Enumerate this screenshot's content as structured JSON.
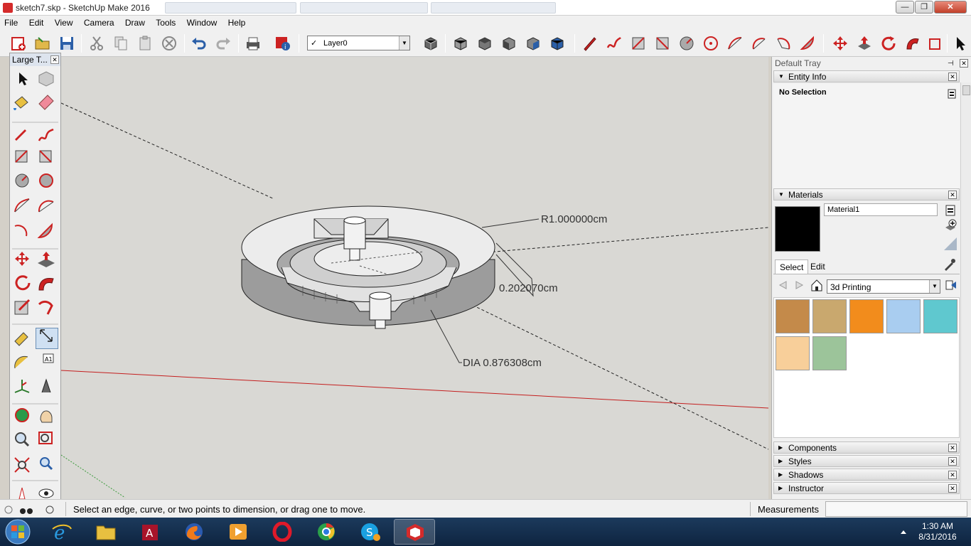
{
  "window": {
    "title": "sketch7.skp - SketchUp Make 2016",
    "minimize": "—",
    "maximize": "❐",
    "close": "✕"
  },
  "menu": [
    "File",
    "Edit",
    "View",
    "Camera",
    "Draw",
    "Tools",
    "Window",
    "Help"
  ],
  "toolbar": {
    "layer_checkmark": "✓",
    "layer_value": "Layer0",
    "dropdown_arrow": "▼"
  },
  "large_toolset": {
    "title": "Large T...",
    "close": "✕"
  },
  "viewport": {
    "dimensions": {
      "radius": "R1.000000cm",
      "linear": "0.202070cm",
      "diameter": "DIA 0.876308cm"
    }
  },
  "tray": {
    "title": "Default Tray",
    "pin": "⊣",
    "close": "✕",
    "entity_info": {
      "header": "Entity Info",
      "status": "No Selection"
    },
    "materials": {
      "header": "Materials",
      "current_name": "Material1",
      "tabs": [
        "Select",
        "Edit"
      ],
      "library": "3d Printing",
      "swatch_colors": [
        "#c48a4a",
        "#c9a86e",
        "#f28c1c",
        "#a9cdf0",
        "#5fc8cf",
        "#f8cf9a",
        "#9cc49a"
      ]
    },
    "collapsed_panels": [
      "Components",
      "Styles",
      "Shadows",
      "Instructor"
    ],
    "collapsed_arrow": "▶",
    "expanded_arrow": "▼"
  },
  "status": {
    "message": "Select an edge, curve, or two points to dimension, or drag one to move.",
    "measurements_label": "Measurements"
  },
  "taskbar": {
    "time": "1:30 AM",
    "date": "8/31/2016"
  }
}
